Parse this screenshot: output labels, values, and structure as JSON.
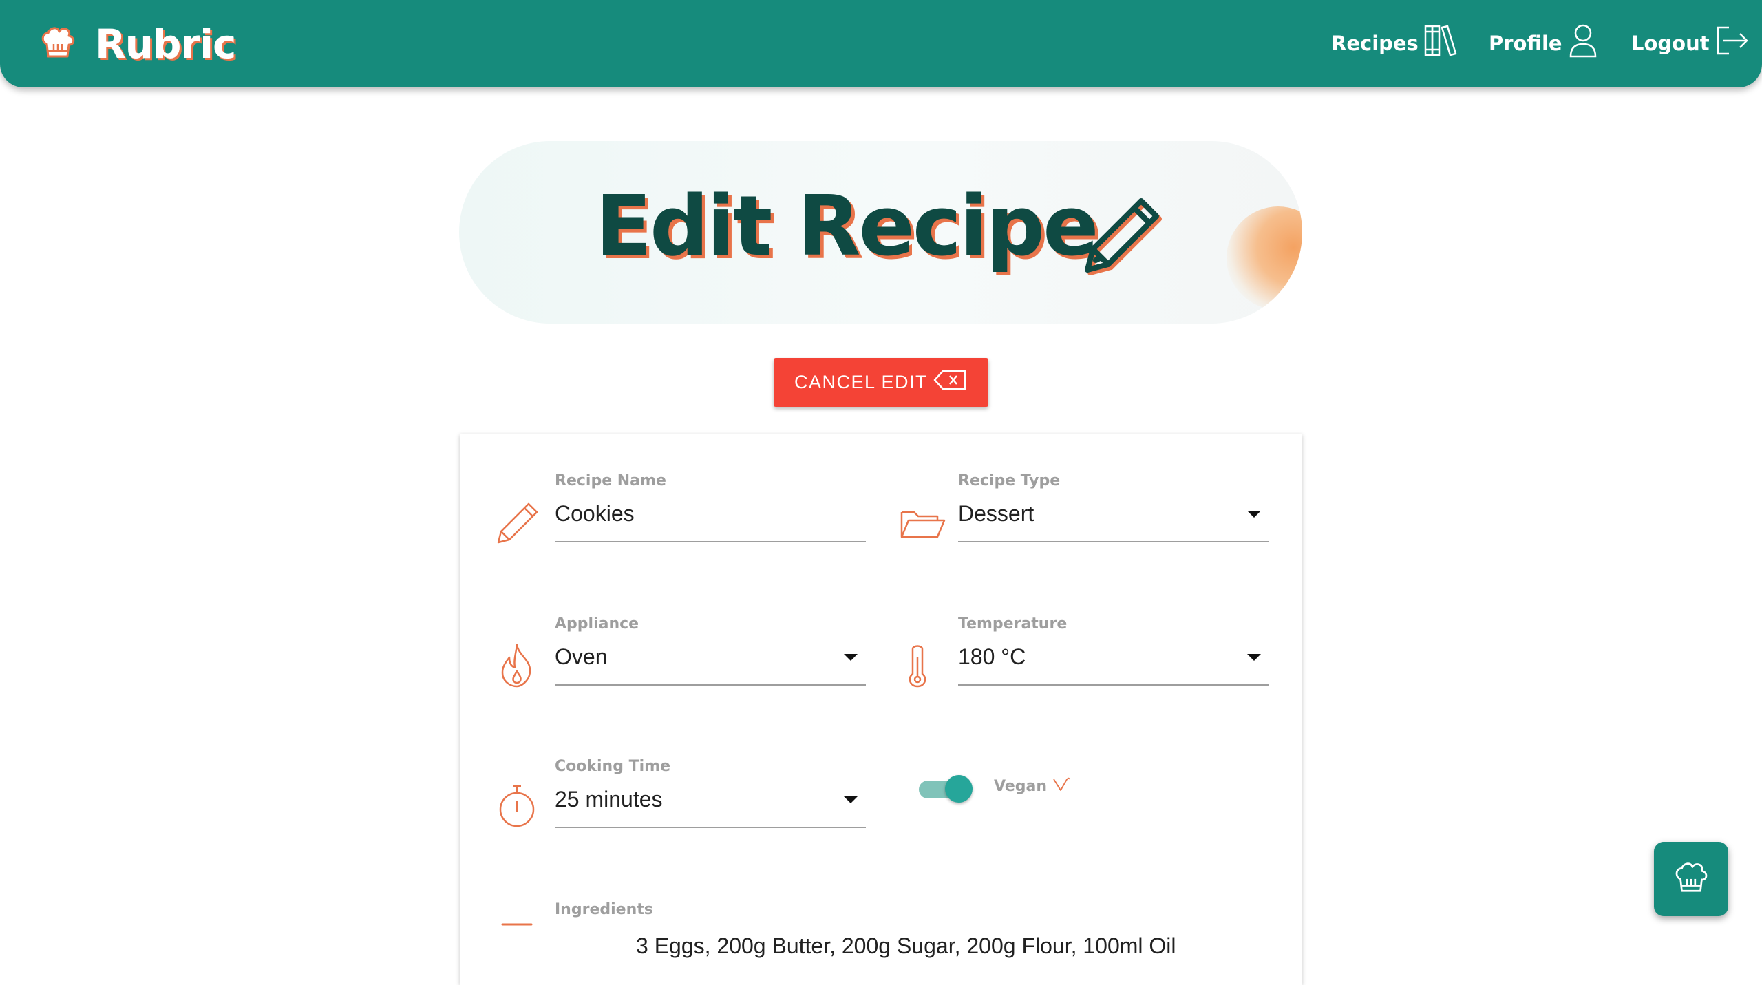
{
  "brand": {
    "name": "Rubric",
    "logo_icon": "chef-hat-icon"
  },
  "nav": [
    {
      "label": "Recipes",
      "icon": "books-icon"
    },
    {
      "label": "Profile",
      "icon": "user-icon"
    },
    {
      "label": "Logout",
      "icon": "logout-icon"
    }
  ],
  "hero": {
    "title": "Edit Recipe",
    "icon": "pencil-icon"
  },
  "cancel_button": {
    "label": "CANCEL EDIT",
    "icon": "backspace-icon"
  },
  "form": {
    "recipe_name": {
      "label": "Recipe Name",
      "value": "Cookies",
      "icon": "pencil-icon"
    },
    "recipe_type": {
      "label": "Recipe Type",
      "value": "Dessert",
      "icon": "folder-open-icon"
    },
    "appliance": {
      "label": "Appliance",
      "value": "Oven",
      "icon": "flame-icon"
    },
    "temperature": {
      "label": "Temperature",
      "value": "180 °C",
      "icon": "thermometer-icon"
    },
    "cooking_time": {
      "label": "Cooking Time",
      "value": "25 minutes",
      "icon": "stopwatch-icon"
    },
    "vegan": {
      "label": "Vegan",
      "checked": true,
      "icon": "vegan-icon"
    },
    "ingredients": {
      "label": "Ingredients",
      "value": "3 Eggs, 200g Butter, 200g Sugar, 200g Flour, 100ml Oil",
      "icon": "list-icon"
    }
  },
  "fab": {
    "icon": "chef-hat-icon"
  },
  "colors": {
    "primary": "#168b7c",
    "accent": "#e8744a",
    "danger": "#f44336",
    "title": "#0f4a43"
  }
}
